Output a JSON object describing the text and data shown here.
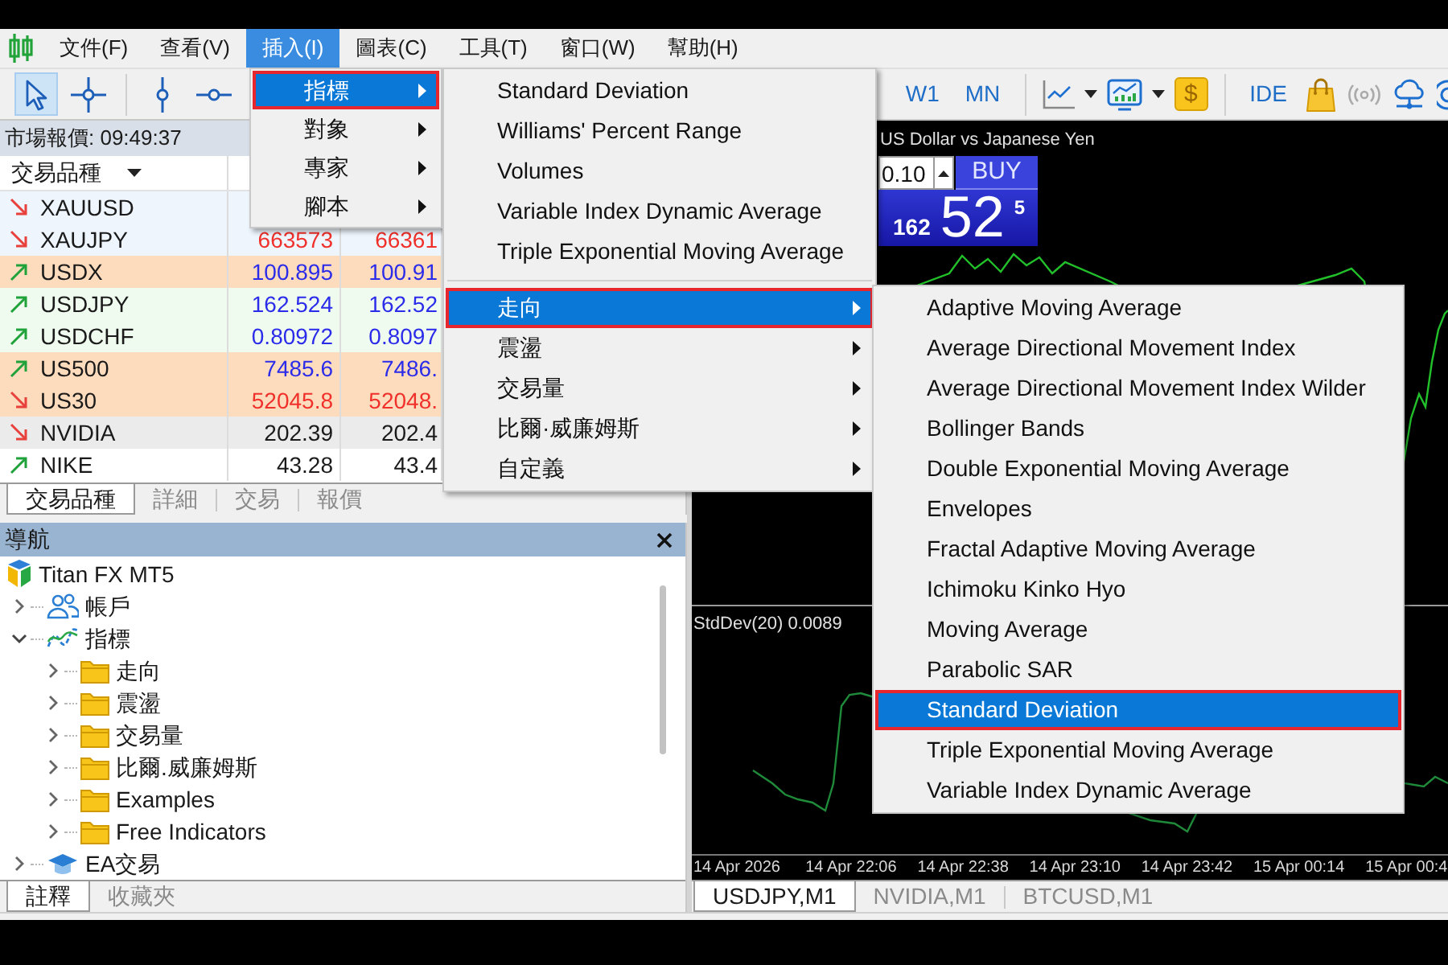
{
  "menu_bar": {
    "items": [
      {
        "label": "文件(F)",
        "selected": false
      },
      {
        "label": "查看(V)",
        "selected": false
      },
      {
        "label": "插入(I)",
        "selected": true
      },
      {
        "label": "圖表(C)",
        "selected": false
      },
      {
        "label": "工具(T)",
        "selected": false
      },
      {
        "label": "窗口(W)",
        "selected": false
      },
      {
        "label": "幫助(H)",
        "selected": false
      }
    ]
  },
  "toolbar": {
    "drawing_tools": [
      {
        "kind": "cursor",
        "selected": true
      },
      {
        "kind": "crosshair",
        "selected": false
      },
      {
        "kind": "vertical_line",
        "selected": false
      },
      {
        "kind": "horizontal_line",
        "selected": false
      }
    ],
    "periods": [
      "W1",
      "MN"
    ],
    "dollar": "$",
    "ide": "IDE"
  },
  "market_watch": {
    "title": "市場報價: 09:49:37",
    "symbol_column": "交易品種",
    "rows": [
      {
        "symbol": "XAUUSD",
        "rising": false,
        "color": "#eef5fd"
      },
      {
        "symbol": "XAUJPY",
        "rising": false,
        "price_changed": true,
        "bid": "663573",
        "ask": "66361",
        "color": "#eef5fd"
      },
      {
        "symbol": "USDX",
        "rising": true,
        "price_changed": true,
        "bid": "100.895",
        "ask": "100.91",
        "color": "#fddbbd"
      },
      {
        "symbol": "USDJPY",
        "rising": true,
        "price_changed": true,
        "bid": "162.524",
        "ask": "162.52",
        "color": "#effbef"
      },
      {
        "symbol": "USDCHF",
        "rising": true,
        "price_changed": true,
        "bid": "0.80972",
        "ask": "0.8097",
        "color": "#effbef"
      },
      {
        "symbol": "US500",
        "rising": true,
        "price_changed": true,
        "bid": "7485.6",
        "ask": "7486.",
        "color": "#fddbbd"
      },
      {
        "symbol": "US30",
        "rising": false,
        "price_changed": true,
        "bid": "52045.8",
        "ask": "52048.",
        "color": "#fddbbd"
      },
      {
        "symbol": "NVIDIA",
        "rising": false,
        "price_changed": false,
        "bid": "202.39",
        "ask": "202.4",
        "color": "#ebebeb"
      },
      {
        "symbol": "NIKE",
        "rising": true,
        "price_changed": false,
        "bid": "43.28",
        "ask": "43.4",
        "color": "#ffffff"
      }
    ],
    "tabs": [
      {
        "label": "交易品種",
        "selected": true
      },
      {
        "label": "詳細",
        "selected": false
      },
      {
        "label": "交易",
        "selected": false
      },
      {
        "label": "報價",
        "selected": false
      }
    ]
  },
  "navigator": {
    "title": "導航",
    "tree": [
      {
        "label": "Titan FX MT5",
        "kind": "broker",
        "children": [
          {
            "label": "帳戶",
            "kind": "accounts",
            "expanded": false
          },
          {
            "label": "指標",
            "kind": "indicators",
            "expanded": true,
            "children": [
              {
                "label": "走向",
                "kind": "folder",
                "expanded": false
              },
              {
                "label": "震盪",
                "kind": "folder",
                "expanded": false
              },
              {
                "label": "交易量",
                "kind": "folder",
                "expanded": false
              },
              {
                "label": "比爾.威廉姆斯",
                "kind": "folder",
                "expanded": false
              },
              {
                "label": "Examples",
                "kind": "folder",
                "expanded": false
              },
              {
                "label": "Free Indicators",
                "kind": "folder",
                "expanded": false
              }
            ]
          },
          {
            "label": "EA交易",
            "kind": "experts",
            "expanded": false
          }
        ]
      }
    ],
    "tabs": [
      {
        "label": "註釋",
        "selected": true
      },
      {
        "label": "收藏夾",
        "selected": false
      }
    ]
  },
  "chart": {
    "title": "US Dollar vs Japanese Yen",
    "trade_panel": {
      "lot": "0.10",
      "buy_label": "BUY",
      "price_prefix": "162",
      "price_main": "52",
      "price_suffix": "5"
    },
    "indicator_label": "StdDev(20) 0.0089",
    "time_axis": [
      "14 Apr 2026",
      "14 Apr 22:06",
      "14 Apr 22:38",
      "14 Apr 23:10",
      "14 Apr 23:42",
      "15 Apr 00:14",
      "15 Apr 00:4"
    ],
    "tabs": [
      {
        "label": "USDJPY,M1",
        "selected": true
      },
      {
        "label": "NVIDIA,M1",
        "selected": false
      },
      {
        "label": "BTCUSD,M1",
        "selected": false
      }
    ]
  },
  "insert_menu": {
    "items": [
      {
        "label": "指標",
        "selected": true
      },
      {
        "label": "對象",
        "selected": false
      },
      {
        "label": "專家",
        "selected": false
      },
      {
        "label": "腳本",
        "selected": false
      }
    ]
  },
  "indicators_menu": {
    "items": [
      {
        "kind": "command",
        "label": "Standard Deviation",
        "selected": false
      },
      {
        "kind": "command",
        "label": "Williams' Percent Range",
        "selected": false
      },
      {
        "kind": "command",
        "label": "Volumes",
        "selected": false
      },
      {
        "kind": "command",
        "label": "Variable Index Dynamic Average",
        "selected": false
      },
      {
        "kind": "command",
        "label": "Triple Exponential Moving Average",
        "selected": false
      },
      {
        "kind": "separator"
      },
      {
        "kind": "submenu",
        "label": "走向",
        "selected": true
      },
      {
        "kind": "submenu",
        "label": "震盪",
        "selected": false
      },
      {
        "kind": "submenu",
        "label": "交易量",
        "selected": false
      },
      {
        "kind": "submenu",
        "label": "比爾·威廉姆斯",
        "selected": false
      },
      {
        "kind": "submenu",
        "label": "自定義",
        "selected": false
      }
    ]
  },
  "trend_menu": {
    "items": [
      {
        "label": "Adaptive Moving Average",
        "selected": false
      },
      {
        "label": "Average Directional Movement Index",
        "selected": false
      },
      {
        "label": "Average Directional Movement Index Wilder",
        "selected": false
      },
      {
        "label": "Bollinger Bands",
        "selected": false
      },
      {
        "label": "Double Exponential Moving Average",
        "selected": false
      },
      {
        "label": "Envelopes",
        "selected": false
      },
      {
        "label": "Fractal Adaptive Moving Average",
        "selected": false
      },
      {
        "label": "Ichimoku Kinko Hyo",
        "selected": false
      },
      {
        "label": "Moving Average",
        "selected": false
      },
      {
        "label": "Parabolic SAR",
        "selected": false
      },
      {
        "label": "Standard Deviation",
        "selected": true
      },
      {
        "label": "Triple Exponential Moving Average",
        "selected": false
      },
      {
        "label": "Variable Index Dynamic Average",
        "selected": false
      }
    ]
  }
}
